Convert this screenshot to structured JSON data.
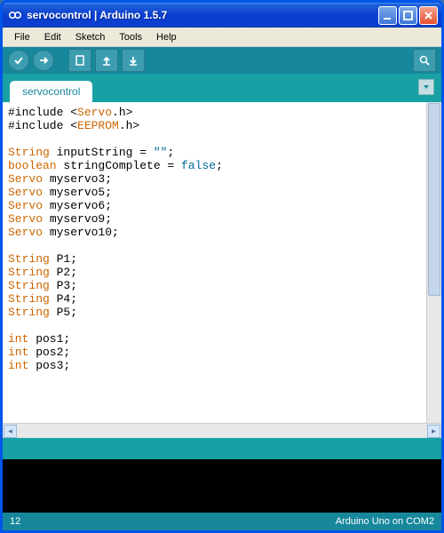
{
  "window": {
    "title": "servocontrol  |  Arduino 1.5.7"
  },
  "menu": {
    "file": "File",
    "edit": "Edit",
    "sketch": "Sketch",
    "tools": "Tools",
    "help": "Help"
  },
  "tabs": {
    "active": "servocontrol"
  },
  "code": {
    "lines": [
      {
        "raw": "#include <",
        "lib": "Servo",
        "tail": ".h>"
      },
      {
        "raw": "#include <",
        "lib": "EEPROM",
        "tail": ".h>"
      },
      {
        "blank": true
      },
      {
        "type": "String",
        "rest": " inputString = ",
        "str": "\"\"",
        "end": ";"
      },
      {
        "type": "boolean",
        "rest": " stringComplete = ",
        "bool": "false",
        "end": ";"
      },
      {
        "type": "Servo",
        "rest": " myservo3;"
      },
      {
        "type": "Servo",
        "rest": " myservo5;"
      },
      {
        "type": "Servo",
        "rest": " myservo6;"
      },
      {
        "type": "Servo",
        "rest": " myservo9;"
      },
      {
        "type": "Servo",
        "rest": " myservo10;"
      },
      {
        "blank": true
      },
      {
        "type": "String",
        "rest": " P1;"
      },
      {
        "type": "String",
        "rest": " P2;"
      },
      {
        "type": "String",
        "rest": " P3;"
      },
      {
        "type": "String",
        "rest": " P4;"
      },
      {
        "type": "String",
        "rest": " P5;"
      },
      {
        "blank": true
      },
      {
        "type": "int",
        "rest": " pos1;"
      },
      {
        "type": "int",
        "rest": " pos2;"
      },
      {
        "type": "int",
        "rest": " pos3;"
      }
    ]
  },
  "status": {
    "line": "12",
    "board": "Arduino Uno on COM2"
  }
}
